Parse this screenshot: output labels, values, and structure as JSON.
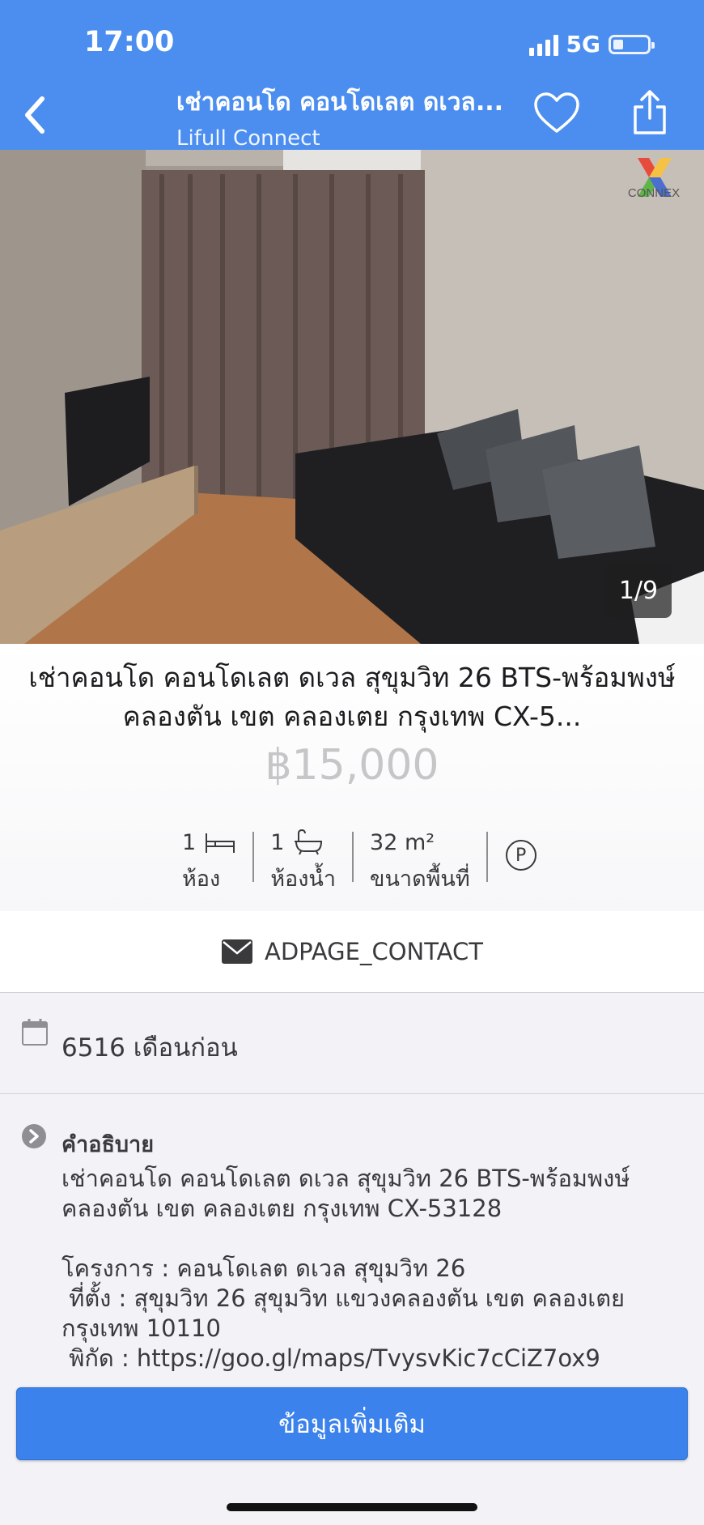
{
  "status_bar": {
    "time": "17:00",
    "network": "5G"
  },
  "nav": {
    "title": "เช่าคอนโด คอนโดเลต ดเวล...",
    "subtitle": "Lifull Connect",
    "back_icon": "chevron-left-icon",
    "favorite_icon": "heart-icon",
    "share_icon": "share-icon"
  },
  "gallery": {
    "counter": "1/9",
    "watermark": "CONNEX"
  },
  "listing": {
    "title": "เช่าคอนโด คอนโดเลต ดเวล สุขุมวิท 26 BTS-พร้อมพงษ์ คลองตัน เขต คลองเตย กรุงเทพ CX-5...",
    "price": "฿15,000",
    "specs": {
      "bedrooms_value": "1",
      "bedrooms_label": "ห้อง",
      "bathrooms_value": "1",
      "bathrooms_label": "ห้องน้ำ",
      "area_value": "32 m²",
      "area_label": "ขนาดพื้นที่",
      "parking_symbol": "P"
    }
  },
  "contact": {
    "label": "ADPAGE_CONTACT"
  },
  "posted": {
    "text": "6516 เดือนก่อน"
  },
  "description": {
    "label": "คำอธิบาย",
    "text": "เช่าคอนโด คอนโดเลต ดเวล สุขุมวิท 26 BTS-พร้อมพงษ์ คลองตัน เขต คลองเตย กรุงเทพ CX-53128\n\nโครงการ : คอนโดเลต ดเวล สุขุมวิท 26\n ที่ตั้ง : สุขุมวิท 26 สุขุมวิท แขวงคลองตัน เขต คลองเตย กรุงเทพ 10110\n พิกัด : https://goo.gl/maps/TvysvKic7cCiZ7ox9"
  },
  "more_button": {
    "label": "ข้อมูลเพิ่มเติม"
  },
  "colors": {
    "brand": "#4b8ef0",
    "button": "#3b82ec"
  }
}
